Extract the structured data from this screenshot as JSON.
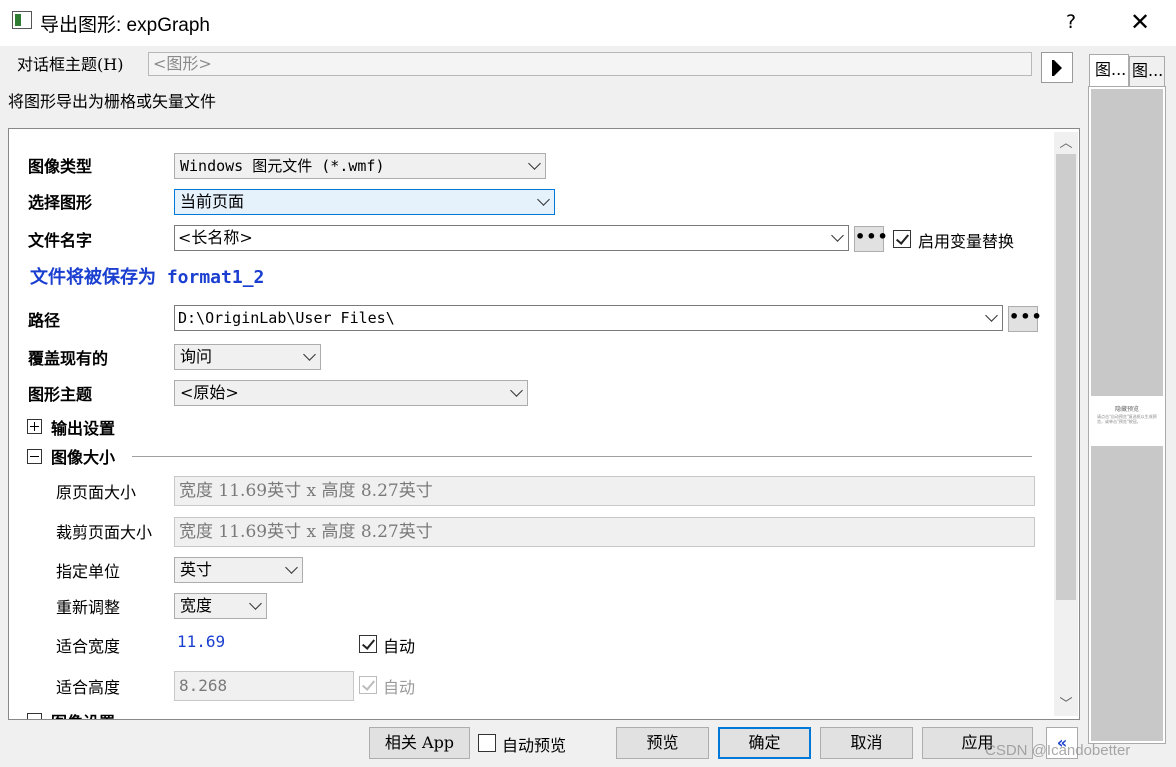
{
  "window": {
    "title": "导出图形: expGraph",
    "help": "?",
    "close": "✕"
  },
  "theme": {
    "label": "对话框主题(H)",
    "value": "<图形>"
  },
  "description": "将图形导出为栅格或矢量文件",
  "side_tabs": [
    "图...",
    "图..."
  ],
  "preview": {
    "title": "隐藏预览",
    "text": "请点击\"自动预览\"复选框以生成预览，或单击\"预览\"按钮。"
  },
  "form": {
    "image_type": {
      "label": "图像类型",
      "value": "Windows 图元文件 (*.wmf)"
    },
    "select_graph": {
      "label": "选择图形",
      "value": "当前页面"
    },
    "file_name": {
      "label": "文件名字",
      "value": "<长名称>",
      "browse": "•••",
      "checkbox_label": "启用变量替换",
      "checked": true
    },
    "save_as_note": "文件将被保存为 format1_2",
    "path": {
      "label": "路径",
      "value": "D:\\OriginLab\\User Files\\",
      "browse": "•••"
    },
    "overwrite": {
      "label": "覆盖现有的",
      "value": "询问"
    },
    "graph_theme": {
      "label": "图形主题",
      "value": "<原始>"
    },
    "output_settings": {
      "label": "输出设置",
      "expanded": false
    },
    "image_size": {
      "label": "图像大小",
      "expanded": true,
      "orig_page_size": {
        "label": "原页面大小",
        "value": "宽度 11.69英寸 x 高度 8.27英寸"
      },
      "crop_page_size": {
        "label": "裁剪页面大小",
        "value": "宽度 11.69英寸 x 高度 8.27英寸"
      },
      "unit": {
        "label": "指定单位",
        "value": "英寸"
      },
      "rescale": {
        "label": "重新调整",
        "value": "宽度"
      },
      "fit_width": {
        "label": "适合宽度",
        "value": "11.69",
        "auto_label": "自动",
        "auto_checked": true
      },
      "fit_height": {
        "label": "适合高度",
        "value": "8.268",
        "auto_label": "自动",
        "auto_checked": true,
        "disabled": true
      }
    },
    "image_settings_partial": "图像设置"
  },
  "buttons": {
    "related_app": "相关 App",
    "auto_preview": "自动预览",
    "preview": "预览",
    "ok": "确定",
    "cancel": "取消",
    "apply": "应用",
    "collapse": "«"
  },
  "watermark": "CSDN @Icandobetter",
  "colors": {
    "accent": "#0078d7",
    "link_blue": "#1a3fd0",
    "selected_field_bg": "#e5f1fb"
  }
}
